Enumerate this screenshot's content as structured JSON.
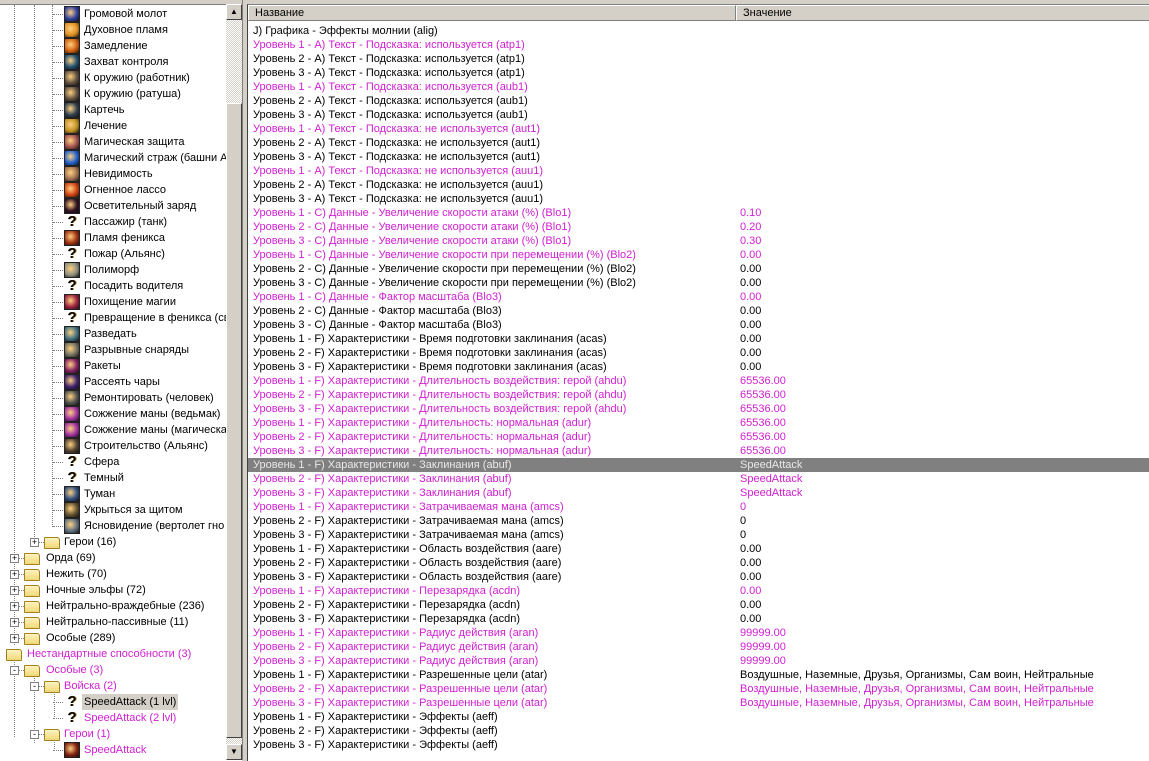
{
  "tree": [
    {
      "label": "Громовой молот",
      "type": "leaf",
      "icon": "spell",
      "color": "#3040a0"
    },
    {
      "label": "Духовное пламя",
      "type": "leaf",
      "icon": "spell",
      "color": "#e09020"
    },
    {
      "label": "Замедление",
      "type": "leaf",
      "icon": "spell",
      "color": "#d06010"
    },
    {
      "label": "Захват контроля",
      "type": "leaf",
      "icon": "spell",
      "color": "#205070"
    },
    {
      "label": "К оружию (работник)",
      "type": "leaf",
      "icon": "spell",
      "color": "#605040"
    },
    {
      "label": "К оружию (ратуша)",
      "type": "leaf",
      "icon": "spell",
      "color": "#605040"
    },
    {
      "label": "Картечь",
      "type": "leaf",
      "icon": "spell",
      "color": "#304050"
    },
    {
      "label": "Лечение",
      "type": "leaf",
      "icon": "spell",
      "color": "#c09020"
    },
    {
      "label": "Магическая защита",
      "type": "leaf",
      "icon": "spell",
      "color": "#a05050"
    },
    {
      "label": "Магический страж (башни А",
      "type": "leaf",
      "icon": "spell",
      "color": "#2060d0"
    },
    {
      "label": "Невидимость",
      "type": "leaf",
      "icon": "spell",
      "color": "#a07050"
    },
    {
      "label": "Огненное лассо",
      "type": "leaf",
      "icon": "spell",
      "color": "#d04010"
    },
    {
      "label": "Осветительный заряд",
      "type": "leaf",
      "icon": "spell",
      "color": "#301020"
    },
    {
      "label": "Пассажир (танк)",
      "type": "leaf",
      "icon": "unknown"
    },
    {
      "label": "Пламя феникса",
      "type": "leaf",
      "icon": "spell",
      "color": "#a03010"
    },
    {
      "label": "Пожар (Альянс)",
      "type": "leaf",
      "icon": "unknown"
    },
    {
      "label": "Полиморф",
      "type": "leaf",
      "icon": "spell",
      "color": "#909080"
    },
    {
      "label": "Посадить водителя",
      "type": "leaf",
      "icon": "unknown"
    },
    {
      "label": "Похищение магии",
      "type": "leaf",
      "icon": "spell",
      "color": "#a02040"
    },
    {
      "label": "Превращение в феникса (св",
      "type": "leaf",
      "icon": "unknown"
    },
    {
      "label": "Разведать",
      "type": "leaf",
      "icon": "spell",
      "color": "#407080"
    },
    {
      "label": "Разрывные снаряды",
      "type": "leaf",
      "icon": "spell",
      "color": "#707060"
    },
    {
      "label": "Ракеты",
      "type": "leaf",
      "icon": "spell",
      "color": "#802060"
    },
    {
      "label": "Рассеять чары",
      "type": "leaf",
      "icon": "spell",
      "color": "#402070"
    },
    {
      "label": "Ремонтировать (человек)",
      "type": "leaf",
      "icon": "spell",
      "color": "#505050"
    },
    {
      "label": "Сожжение маны (ведьмак)",
      "type": "leaf",
      "icon": "spell",
      "color": "#a030a0"
    },
    {
      "label": "Сожжение маны (магическа",
      "type": "leaf",
      "icon": "spell",
      "color": "#a030a0"
    },
    {
      "label": "Строительство (Альянс)",
      "type": "leaf",
      "icon": "spell",
      "color": "#504030"
    },
    {
      "label": "Сфера",
      "type": "leaf",
      "icon": "unknown"
    },
    {
      "label": "Темный",
      "type": "leaf",
      "icon": "unknown"
    },
    {
      "label": "Туман",
      "type": "leaf",
      "icon": "spell",
      "color": "#305080"
    },
    {
      "label": "Укрыться за щитом",
      "type": "leaf",
      "icon": "spell",
      "color": "#605030"
    },
    {
      "label": "Ясновидение (вертолет гно",
      "type": "leaf",
      "icon": "spell",
      "color": "#607080"
    },
    {
      "label": "Герои (16)",
      "type": "folder",
      "level": 1,
      "expander": "+"
    },
    {
      "label": "Орда (69)",
      "type": "folder",
      "level": 0,
      "expander": "+"
    },
    {
      "label": "Нежить (70)",
      "type": "folder",
      "level": 0,
      "expander": "+"
    },
    {
      "label": "Ночные эльфы (72)",
      "type": "folder",
      "level": 0,
      "expander": "+"
    },
    {
      "label": "Нейтрально-враждебные (236)",
      "type": "folder",
      "level": 0,
      "expander": "+"
    },
    {
      "label": "Нейтрально-пассивные (11)",
      "type": "folder",
      "level": 0,
      "expander": "+"
    },
    {
      "label": "Особые (289)",
      "type": "folder",
      "level": 0,
      "expander": "+"
    },
    {
      "label": "Нестандартные способности (3)",
      "type": "root",
      "custom": true
    },
    {
      "label": "Особые (3)",
      "type": "folder",
      "level": 0,
      "expander": "-",
      "custom": true
    },
    {
      "label": "Войска (2)",
      "type": "folder",
      "level": 1,
      "expander": "-",
      "custom": true
    },
    {
      "label": "SpeedAttack (1 lvl)",
      "type": "leaf",
      "icon": "unknown",
      "custom": true,
      "selected": true
    },
    {
      "label": "SpeedAttack (2 lvl)",
      "type": "leaf",
      "icon": "unknown",
      "custom": true
    },
    {
      "label": "Герои (1)",
      "type": "folder",
      "level": 1,
      "expander": "-",
      "custom": true
    },
    {
      "label": "SpeedAttack",
      "type": "leaf",
      "icon": "spell",
      "color": "#802010",
      "custom": true
    }
  ],
  "table": {
    "headers": {
      "name": "Название",
      "value": "Значение"
    },
    "selected_row": 32,
    "rows": [
      {
        "n": "J) Графика - Эффекты молнии (alig)",
        "v": "",
        "m": false
      },
      {
        "n": "Уровень 1 - A) Текст - Подсказка: используется (atp1)",
        "v": "",
        "m": true
      },
      {
        "n": "Уровень 2 - A) Текст - Подсказка: используется (atp1)",
        "v": "",
        "m": false
      },
      {
        "n": "Уровень 3 - A) Текст - Подсказка: используется (atp1)",
        "v": "",
        "m": false
      },
      {
        "n": "Уровень 1 - A) Текст - Подсказка: используется (aub1)",
        "v": "",
        "m": true
      },
      {
        "n": "Уровень 2 - A) Текст - Подсказка: используется (aub1)",
        "v": "",
        "m": false
      },
      {
        "n": "Уровень 3 - A) Текст - Подсказка: используется (aub1)",
        "v": "",
        "m": false
      },
      {
        "n": "Уровень 1 - A) Текст - Подсказка: не используется (aut1)",
        "v": "",
        "m": true
      },
      {
        "n": "Уровень 2 - A) Текст - Подсказка: не используется (aut1)",
        "v": "",
        "m": false
      },
      {
        "n": "Уровень 3 - A) Текст - Подсказка: не используется (aut1)",
        "v": "",
        "m": false
      },
      {
        "n": "Уровень 1 - A) Текст - Подсказка: не используется (auu1)",
        "v": "",
        "m": true
      },
      {
        "n": "Уровень 2 - A) Текст - Подсказка: не используется (auu1)",
        "v": "",
        "m": false
      },
      {
        "n": "Уровень 3 - A) Текст - Подсказка: не используется (auu1)",
        "v": "",
        "m": false
      },
      {
        "n": "Уровень 1 - C) Данные - Увеличение скорости атаки (%) (Blo1)",
        "v": "0.10",
        "m": true
      },
      {
        "n": "Уровень 2 - C) Данные - Увеличение скорости атаки (%) (Blo1)",
        "v": "0.20",
        "m": true
      },
      {
        "n": "Уровень 3 - C) Данные - Увеличение скорости атаки (%) (Blo1)",
        "v": "0.30",
        "m": true
      },
      {
        "n": "Уровень 1 - C) Данные - Увеличение скорости при перемещении (%) (Blo2)",
        "v": "0.00",
        "m": true
      },
      {
        "n": "Уровень 2 - C) Данные - Увеличение скорости при перемещении (%) (Blo2)",
        "v": "0.00",
        "m": false
      },
      {
        "n": "Уровень 3 - C) Данные - Увеличение скорости при перемещении (%) (Blo2)",
        "v": "0.00",
        "m": false
      },
      {
        "n": "Уровень 1 - C) Данные - Фактор масштаба (Blo3)",
        "v": "0.00",
        "m": true
      },
      {
        "n": "Уровень 2 - C) Данные - Фактор масштаба (Blo3)",
        "v": "0.00",
        "m": false
      },
      {
        "n": "Уровень 3 - C) Данные - Фактор масштаба (Blo3)",
        "v": "0.00",
        "m": false
      },
      {
        "n": "Уровень 1 - F) Характеристики - Время подготовки заклинания (acas)",
        "v": "0.00",
        "m": false
      },
      {
        "n": "Уровень 2 - F) Характеристики - Время подготовки заклинания (acas)",
        "v": "0.00",
        "m": false
      },
      {
        "n": "Уровень 3 - F) Характеристики - Время подготовки заклинания (acas)",
        "v": "0.00",
        "m": false
      },
      {
        "n": "Уровень 1 - F) Характеристики - Длительность воздействия: герой (ahdu)",
        "v": "65536.00",
        "m": true
      },
      {
        "n": "Уровень 2 - F) Характеристики - Длительность воздействия: герой (ahdu)",
        "v": "65536.00",
        "m": true
      },
      {
        "n": "Уровень 3 - F) Характеристики - Длительность воздействия: герой (ahdu)",
        "v": "65536.00",
        "m": true
      },
      {
        "n": "Уровень 1 - F) Характеристики - Длительность: нормальная (adur)",
        "v": "65536.00",
        "m": true
      },
      {
        "n": "Уровень 2 - F) Характеристики - Длительность: нормальная (adur)",
        "v": "65536.00",
        "m": true
      },
      {
        "n": "Уровень 3 - F) Характеристики - Длительность: нормальная (adur)",
        "v": "65536.00",
        "m": true
      },
      {
        "n": "Уровень 1 - F) Характеристики - Заклинания (abuf)",
        "v": "SpeedAttack",
        "m": true
      },
      {
        "n": "Уровень 2 - F) Характеристики - Заклинания (abuf)",
        "v": "SpeedAttack",
        "m": true
      },
      {
        "n": "Уровень 3 - F) Характеристики - Заклинания (abuf)",
        "v": "SpeedAttack",
        "m": true
      },
      {
        "n": "Уровень 1 - F) Характеристики - Затрачиваемая мана (amcs)",
        "v": "0",
        "m": true
      },
      {
        "n": "Уровень 2 - F) Характеристики - Затрачиваемая мана (amcs)",
        "v": "0",
        "m": false
      },
      {
        "n": "Уровень 3 - F) Характеристики - Затрачиваемая мана (amcs)",
        "v": "0",
        "m": false
      },
      {
        "n": "Уровень 1 - F) Характеристики - Область воздействия (aare)",
        "v": "0.00",
        "m": false
      },
      {
        "n": "Уровень 2 - F) Характеристики - Область воздействия (aare)",
        "v": "0.00",
        "m": false
      },
      {
        "n": "Уровень 3 - F) Характеристики - Область воздействия (aare)",
        "v": "0.00",
        "m": false
      },
      {
        "n": "Уровень 1 - F) Характеристики - Перезарядка (acdn)",
        "v": "0.00",
        "m": true
      },
      {
        "n": "Уровень 2 - F) Характеристики - Перезарядка (acdn)",
        "v": "0.00",
        "m": false
      },
      {
        "n": "Уровень 3 - F) Характеристики - Перезарядка (acdn)",
        "v": "0.00",
        "m": false
      },
      {
        "n": "Уровень 1 - F) Характеристики - Радиус действия (aran)",
        "v": "99999.00",
        "m": true
      },
      {
        "n": "Уровень 2 - F) Характеристики - Радиус действия (aran)",
        "v": "99999.00",
        "m": true
      },
      {
        "n": "Уровень 3 - F) Характеристики - Радиус действия (aran)",
        "v": "99999.00",
        "m": true
      },
      {
        "n": "Уровень 1 - F) Характеристики - Разрешенные цели (atar)",
        "v": "Воздушные, Наземные, Друзья, Организмы, Сам воин, Нейтральные",
        "m": false
      },
      {
        "n": "Уровень 2 - F) Характеристики - Разрешенные цели (atar)",
        "v": "Воздушные, Наземные, Друзья, Организмы, Сам воин, Нейтральные",
        "m": true
      },
      {
        "n": "Уровень 3 - F) Характеристики - Разрешенные цели (atar)",
        "v": "Воздушные, Наземные, Друзья, Организмы, Сам воин, Нейтральные",
        "m": true
      },
      {
        "n": "Уровень 1 - F) Характеристики - Эффекты (aeff)",
        "v": "",
        "m": false
      },
      {
        "n": "Уровень 2 - F) Характеристики - Эффекты (aeff)",
        "v": "",
        "m": false
      },
      {
        "n": "Уровень 3 - F) Характеристики - Эффекты (aeff)",
        "v": "",
        "m": false
      }
    ]
  },
  "scrollbar": {
    "up_arrow": "▲",
    "down_arrow": "▼"
  },
  "colors": {
    "modified": "#d020d0",
    "selected_row": "#808080"
  }
}
